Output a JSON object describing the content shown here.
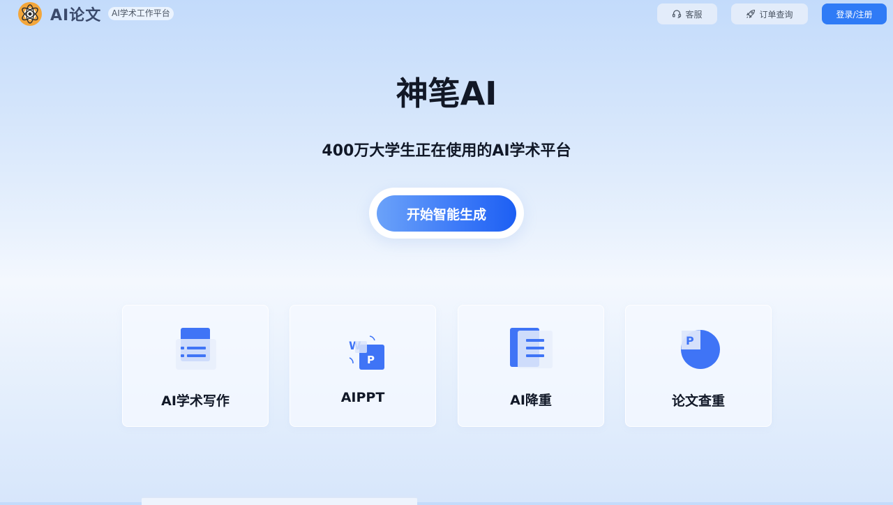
{
  "header": {
    "brand": "AI论文",
    "tagline": "AI学术工作平台",
    "customer_service": "客服",
    "order_query": "订单查询",
    "login": "登录/注册"
  },
  "hero": {
    "title": "神笔AI",
    "subtitle": "400万大学生正在使用的AI学术平台",
    "cta": "开始智能生成"
  },
  "features": [
    {
      "label": "AI学术写作",
      "icon": "document-list-icon"
    },
    {
      "label": "AIPPT",
      "icon": "word-to-ppt-icon"
    },
    {
      "label": "AI降重",
      "icon": "rewrite-document-icon"
    },
    {
      "label": "论文查重",
      "icon": "plagiarism-check-icon"
    }
  ],
  "colors": {
    "primary": "#2f7bf6",
    "cta_start": "#6ba2f9",
    "cta_end": "#1d5ff3",
    "icon_blue": "#3f74f6"
  }
}
